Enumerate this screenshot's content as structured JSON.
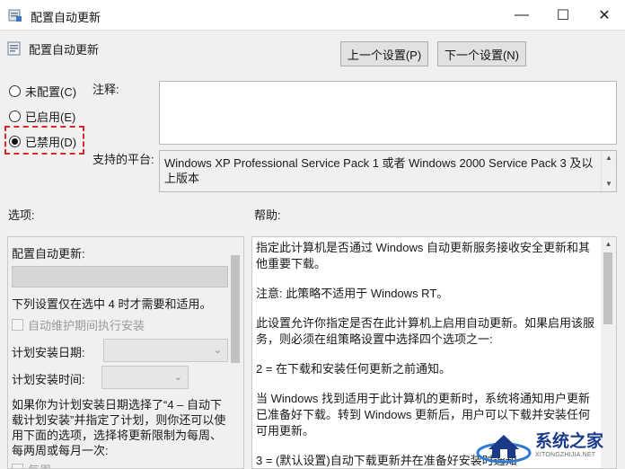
{
  "window": {
    "title": "配置自动更新",
    "minimize_glyph": "—",
    "maximize_glyph": "☐",
    "close_glyph": "✕"
  },
  "policy": {
    "name": "配置自动更新",
    "prev_label": "上一个设置(P)",
    "next_label": "下一个设置(N)"
  },
  "state": {
    "options": [
      {
        "label": "未配置(C)",
        "checked": false
      },
      {
        "label": "已启用(E)",
        "checked": false
      },
      {
        "label": "已禁用(D)",
        "checked": true
      }
    ],
    "highlight_color": "#d62828"
  },
  "comment": {
    "label": "注释:",
    "value": ""
  },
  "platform": {
    "label": "支持的平台:",
    "text": "Windows XP Professional Service Pack 1 或者 Windows 2000 Service Pack 3 及以上版本"
  },
  "options_pane": {
    "heading": "选项:",
    "title": "配置自动更新:",
    "note": "下列设置仅在选中 4 时才需要和适用。",
    "maintenance_checkbox": "自动维护期间执行安装",
    "install_day_label": "计划安装日期:",
    "install_time_label": "计划安装时间:",
    "description": "如果你为计划安装日期选择了“4 – 自动下载计划安装”并指定了计划，则你还可以使用下面的选项，选择将更新限制为每周、每两周或每月一次:",
    "weekly_checkbox": "每周"
  },
  "help_pane": {
    "heading": "帮助:",
    "paragraphs": [
      "指定此计算机是否通过 Windows 自动更新服务接收安全更新和其他重要下载。",
      "注意: 此策略不适用于 Windows RT。",
      "此设置允许你指定是否在此计算机上启用自动更新。如果启用该服务，则必须在组策略设置中选择四个选项之一:",
      "2 = 在下载和安装任何更新之前通知。",
      "当 Windows 找到适用于此计算机的更新时，系统将通知用户更新已准备好下载。转到 Windows 更新后，用户可以下载并安装任何可用更新。",
      "3 = (默认设置)自动下载更新并在准备好安装时通知"
    ]
  },
  "watermark": {
    "brand": "系统之家",
    "domain": "XITONGZHIJIA.NET"
  }
}
